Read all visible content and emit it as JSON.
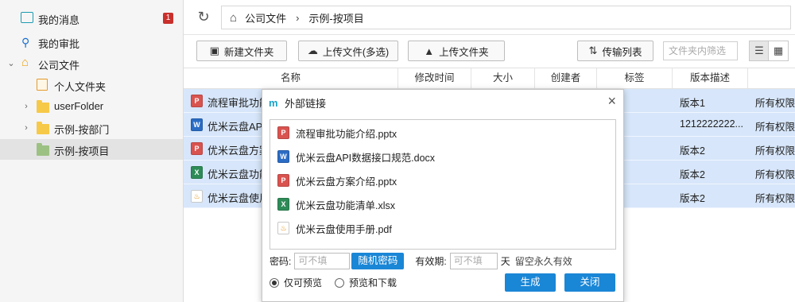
{
  "sidebar": {
    "messages": {
      "label": "我的消息",
      "badge": "1"
    },
    "approvals": {
      "label": "我的审批"
    },
    "company": {
      "label": "公司文件"
    },
    "children": [
      {
        "label": "个人文件夹"
      },
      {
        "label": "userFolder"
      },
      {
        "label": "示例-按部门"
      },
      {
        "label": "示例-按项目"
      }
    ]
  },
  "breadcrumb": {
    "root": "公司文件",
    "current": "示例-按项目"
  },
  "toolbar": {
    "new_folder": "新建文件夹",
    "upload_multi": "上传文件(多选)",
    "upload_folder": "上传文件夹",
    "transfer_list": "传输列表",
    "filter_placeholder": "文件夹内筛选"
  },
  "table": {
    "headers": [
      "名称",
      "修改时间",
      "大小",
      "创建者",
      "标签",
      "版本描述"
    ],
    "rows": [
      {
        "name": "流程审批功能",
        "type": "pptx",
        "version": "版本1",
        "perm": "所有权限"
      },
      {
        "name": "优米云盘API",
        "type": "docx",
        "version": "1212222222...",
        "perm": "所有权限"
      },
      {
        "name": "优米云盘方案",
        "type": "pptx",
        "version": "版本2",
        "perm": "所有权限"
      },
      {
        "name": "优米云盘功能",
        "type": "xlsx",
        "version": "版本2",
        "perm": "所有权限"
      },
      {
        "name": "优米云盘使用",
        "type": "pdf",
        "version": "版本2",
        "perm": "所有权限"
      }
    ]
  },
  "modal": {
    "title": "外部链接",
    "files": [
      {
        "name": "流程审批功能介绍.pptx",
        "type": "pptx"
      },
      {
        "name": "优米云盘API数据接口规范.docx",
        "type": "docx"
      },
      {
        "name": "优米云盘方案介绍.pptx",
        "type": "pptx"
      },
      {
        "name": "优米云盘功能清单.xlsx",
        "type": "xlsx"
      },
      {
        "name": "优米云盘使用手册.pdf",
        "type": "pdf"
      }
    ],
    "password_label": "密码:",
    "password_placeholder": "可不填",
    "random_password": "随机密码",
    "validity_label": "有效期:",
    "validity_placeholder": "可不填",
    "days_unit": "天",
    "validity_hint": "留空永久有效",
    "option_preview": "仅可预览",
    "option_download": "预览和下载",
    "generate": "生成",
    "close": "关闭"
  }
}
